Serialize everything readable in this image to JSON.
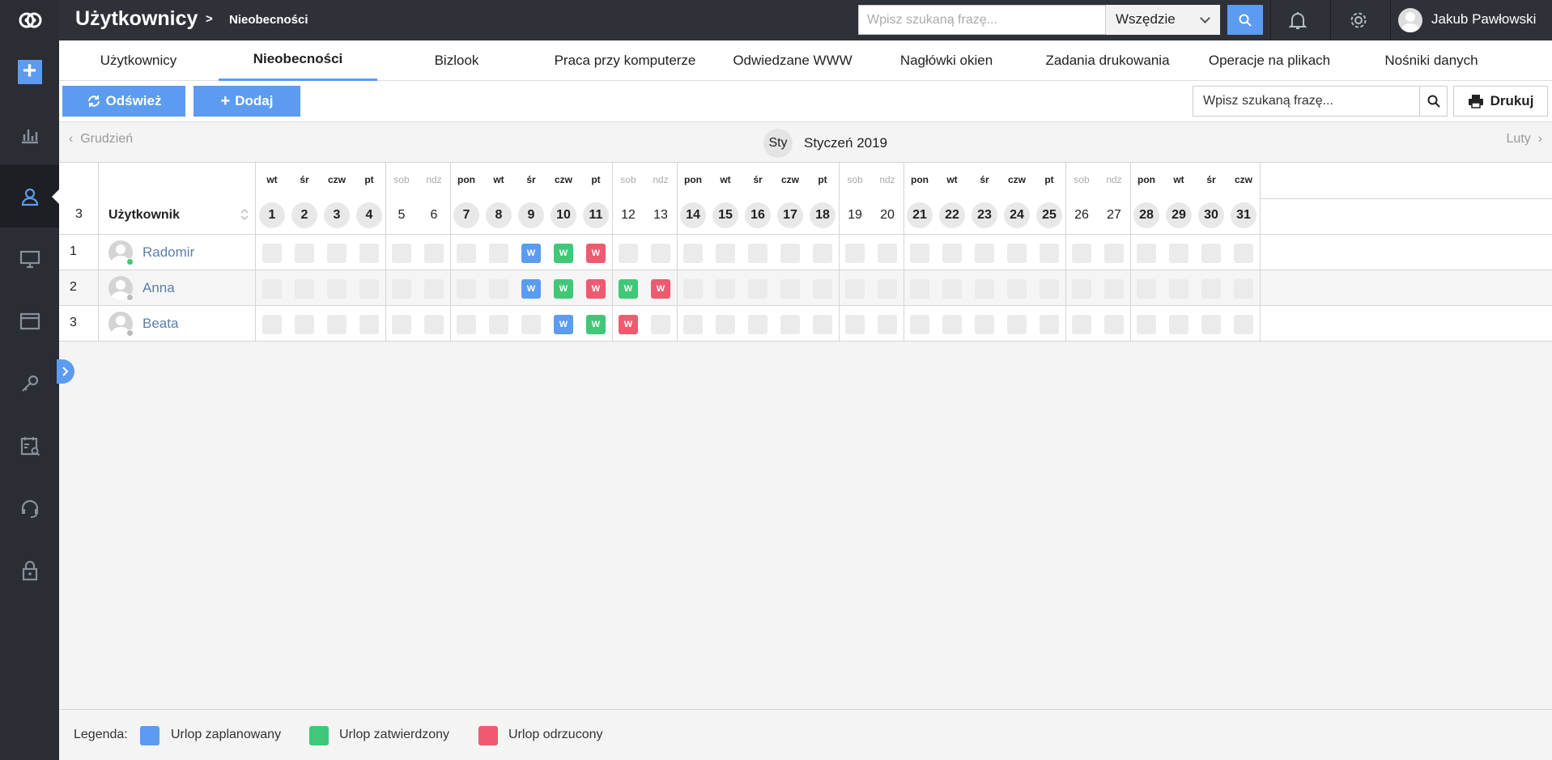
{
  "topbar": {
    "title": "Użytkownicy",
    "separator": ">",
    "subtitle": "Nieobecności",
    "search_placeholder": "Wpisz szukaną frazę...",
    "scope": "Wszędzie",
    "user_name": "Jakub Pawłowski"
  },
  "sidebar": {
    "items": [
      "add",
      "reports-icon",
      "users-icon",
      "computer-icon",
      "window-icon",
      "key-icon",
      "tasks-icon",
      "support-icon",
      "lock-icon"
    ],
    "active": "users-icon"
  },
  "tabs": [
    {
      "label": "Użytkownicy"
    },
    {
      "label": "Nieobecności",
      "active": true
    },
    {
      "label": "Bizlook"
    },
    {
      "label": "Praca przy komputerze"
    },
    {
      "label": "Odwiedzane WWW"
    },
    {
      "label": "Nagłówki okien"
    },
    {
      "label": "Zadania drukowania"
    },
    {
      "label": "Operacje na plikach"
    },
    {
      "label": "Nośniki danych"
    }
  ],
  "toolbar": {
    "refresh_label": "Odśwież",
    "add_label": "Dodaj",
    "search_placeholder": "Wpisz szukaną frazę...",
    "print_label": "Drukuj"
  },
  "month_nav": {
    "prev": "Grudzień",
    "next": "Luty",
    "pill": "Sty",
    "title": "Styczeń 2019"
  },
  "grid": {
    "count": "3",
    "user_header": "Użytkownik",
    "days": [
      {
        "n": "1",
        "d": "wt"
      },
      {
        "n": "2",
        "d": "śr"
      },
      {
        "n": "3",
        "d": "czw"
      },
      {
        "n": "4",
        "d": "pt"
      },
      {
        "n": "5",
        "d": "sob",
        "we": true
      },
      {
        "n": "6",
        "d": "ndz",
        "we": true
      },
      {
        "n": "7",
        "d": "pon"
      },
      {
        "n": "8",
        "d": "wt"
      },
      {
        "n": "9",
        "d": "śr"
      },
      {
        "n": "10",
        "d": "czw"
      },
      {
        "n": "11",
        "d": "pt"
      },
      {
        "n": "12",
        "d": "sob",
        "we": true
      },
      {
        "n": "13",
        "d": "ndz",
        "we": true
      },
      {
        "n": "14",
        "d": "pon"
      },
      {
        "n": "15",
        "d": "wt"
      },
      {
        "n": "16",
        "d": "śr"
      },
      {
        "n": "17",
        "d": "czw"
      },
      {
        "n": "18",
        "d": "pt"
      },
      {
        "n": "19",
        "d": "sob",
        "we": true
      },
      {
        "n": "20",
        "d": "ndz",
        "we": true
      },
      {
        "n": "21",
        "d": "pon"
      },
      {
        "n": "22",
        "d": "wt"
      },
      {
        "n": "23",
        "d": "śr"
      },
      {
        "n": "24",
        "d": "czw"
      },
      {
        "n": "25",
        "d": "pt"
      },
      {
        "n": "26",
        "d": "sob",
        "we": true
      },
      {
        "n": "27",
        "d": "ndz",
        "we": true
      },
      {
        "n": "28",
        "d": "pon"
      },
      {
        "n": "29",
        "d": "wt"
      },
      {
        "n": "30",
        "d": "śr"
      },
      {
        "n": "31",
        "d": "czw"
      }
    ],
    "rows": [
      {
        "num": "1",
        "name": "Radomir",
        "online": true,
        "absences": {
          "9": "planned",
          "10": "approved",
          "11": "rejected"
        }
      },
      {
        "num": "2",
        "name": "Anna",
        "online": false,
        "absences": {
          "9": "planned",
          "10": "approved",
          "11": "rejected",
          "12": "approved",
          "13": "rejected"
        }
      },
      {
        "num": "3",
        "name": "Beata",
        "online": false,
        "absences": {
          "10": "planned",
          "11": "approved",
          "12": "rejected"
        }
      }
    ],
    "absence_mark": "W"
  },
  "legend": {
    "label": "Legenda:",
    "items": [
      {
        "label": "Urlop zaplanowany",
        "color": "#5b9cf0"
      },
      {
        "label": "Urlop zatwierdzony",
        "color": "#40c878"
      },
      {
        "label": "Urlop odrzucony",
        "color": "#f05a70"
      }
    ]
  },
  "colors": {
    "accent": "#5b9cf0",
    "online": "#40c878",
    "offline": "#bbbbbb"
  }
}
